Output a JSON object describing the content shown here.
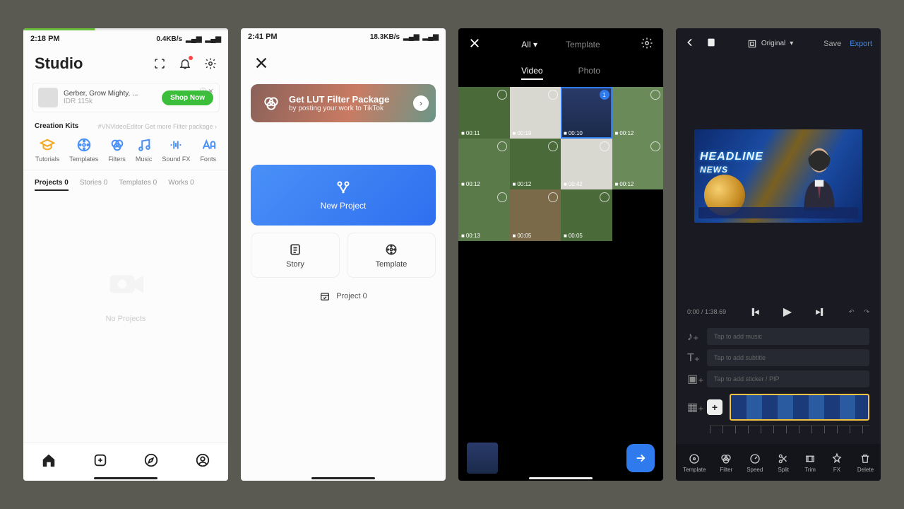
{
  "s1": {
    "status_time": "2:18 PM",
    "status_net": "0.4KB/s",
    "title": "Studio",
    "ad_title": "Gerber, Grow Mighty, ...",
    "ad_sub": "IDR 115k",
    "ad_btn": "Shop Now",
    "ck_label": "Creation Kits",
    "ck_more": "#VNVideoEditor Get more Filter package",
    "kits": [
      "Tutorials",
      "Templates",
      "Filters",
      "Music",
      "Sound FX",
      "Fonts"
    ],
    "tabs": [
      "Projects 0",
      "Stories 0",
      "Templates 0",
      "Works 0"
    ],
    "empty": "No Projects"
  },
  "s2": {
    "status_time": "2:41 PM",
    "status_net": "18.3KB/s",
    "banner_title": "Get LUT Filter Package",
    "banner_sub": "by posting your work to TikTok",
    "new_project": "New Project",
    "story": "Story",
    "template": "Template",
    "project": "Project 0"
  },
  "s3": {
    "filter": "All",
    "template": "Template",
    "tab_video": "Video",
    "tab_photo": "Photo",
    "durations": [
      "00:11",
      "00:19",
      "00:10",
      "00:12",
      "00:12",
      "00:12",
      "00:42",
      "00:12",
      "00:13",
      "00:05",
      "00:05"
    ],
    "selected_badge": "1"
  },
  "s4": {
    "aspect": "Original",
    "save": "Save",
    "export": "Export",
    "time_cur": "0:00",
    "time_total": "1:38.69",
    "headline": "HEADLINE",
    "headline2": "NEWS",
    "ph_music": "Tap to add music",
    "ph_sub": "Tap to add subtitle",
    "ph_sticker": "Tap to add sticker / PIP",
    "tools": [
      "Template",
      "Filter",
      "Speed",
      "Split",
      "Trim",
      "FX",
      "Delete"
    ]
  }
}
